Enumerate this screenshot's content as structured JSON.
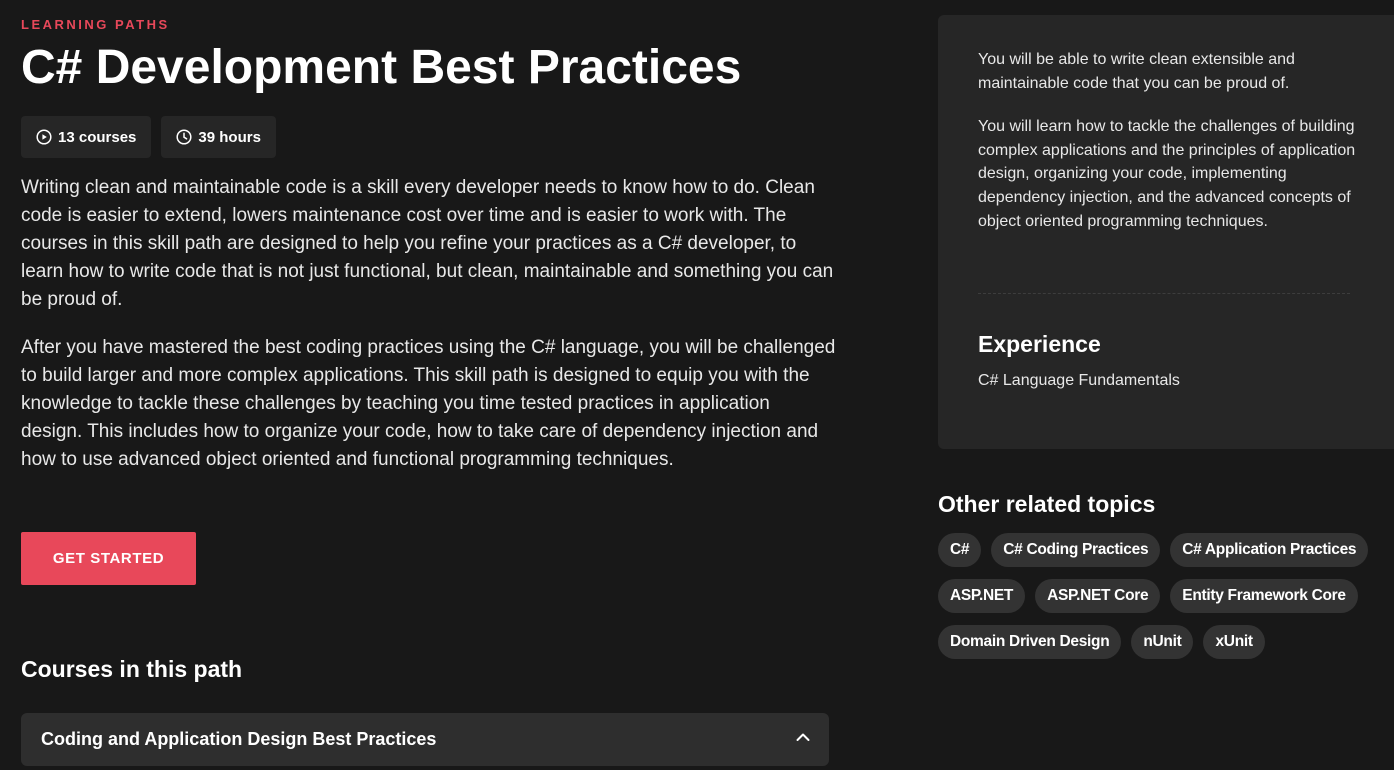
{
  "header": {
    "eyebrow": "LEARNING PATHS",
    "title": "C# Development Best Practices"
  },
  "stats": {
    "courses": "13 courses",
    "hours": "39 hours",
    "courses_icon": "play-circle-icon",
    "hours_icon": "clock-icon"
  },
  "description": {
    "paragraph_1": "Writing clean and maintainable code is a skill every developer needs to know how to do. Clean code is easier to extend, lowers maintenance cost over time and is easier to work with. The courses in this skill path are designed to help you refine your practices as a C# developer, to learn how to write code that is not just functional, but clean, maintainable and something you can be proud of.",
    "paragraph_2": "After you have mastered the best coding practices using the C# language, you will be challenged to build larger and more complex applications. This skill path is designed to equip you with the knowledge to tackle these challenges by teaching you time tested practices in application design. This includes how to organize your code, how to take care of dependency injection and how to use advanced object oriented and functional programming techniques."
  },
  "cta": {
    "label": "GET STARTED"
  },
  "courses": {
    "heading": "Courses in this path",
    "sections": [
      {
        "title": "Coding and Application Design Best Practices",
        "icon": "chevron-up-icon"
      }
    ]
  },
  "info_card": {
    "outcome_1": "You will be able to write clean extensible and maintainable code that you can be proud of.",
    "outcome_2": "You will learn how to tackle the challenges of building complex applications and the principles of application design, organizing your code, implementing dependency injection, and the advanced concepts of object oriented programming techniques.",
    "experience_heading": "Experience",
    "experience_value": "C# Language Fundamentals"
  },
  "related": {
    "heading": "Other related topics",
    "tags": [
      "C#",
      "C# Coding Practices",
      "C# Application Practices",
      "ASP.NET",
      "ASP.NET Core",
      "Entity Framework Core",
      "Domain Driven Design",
      "nUnit",
      "xUnit"
    ]
  },
  "colors": {
    "accent": "#e8485a",
    "background": "#181818",
    "card": "#262626",
    "tag": "#333333"
  }
}
